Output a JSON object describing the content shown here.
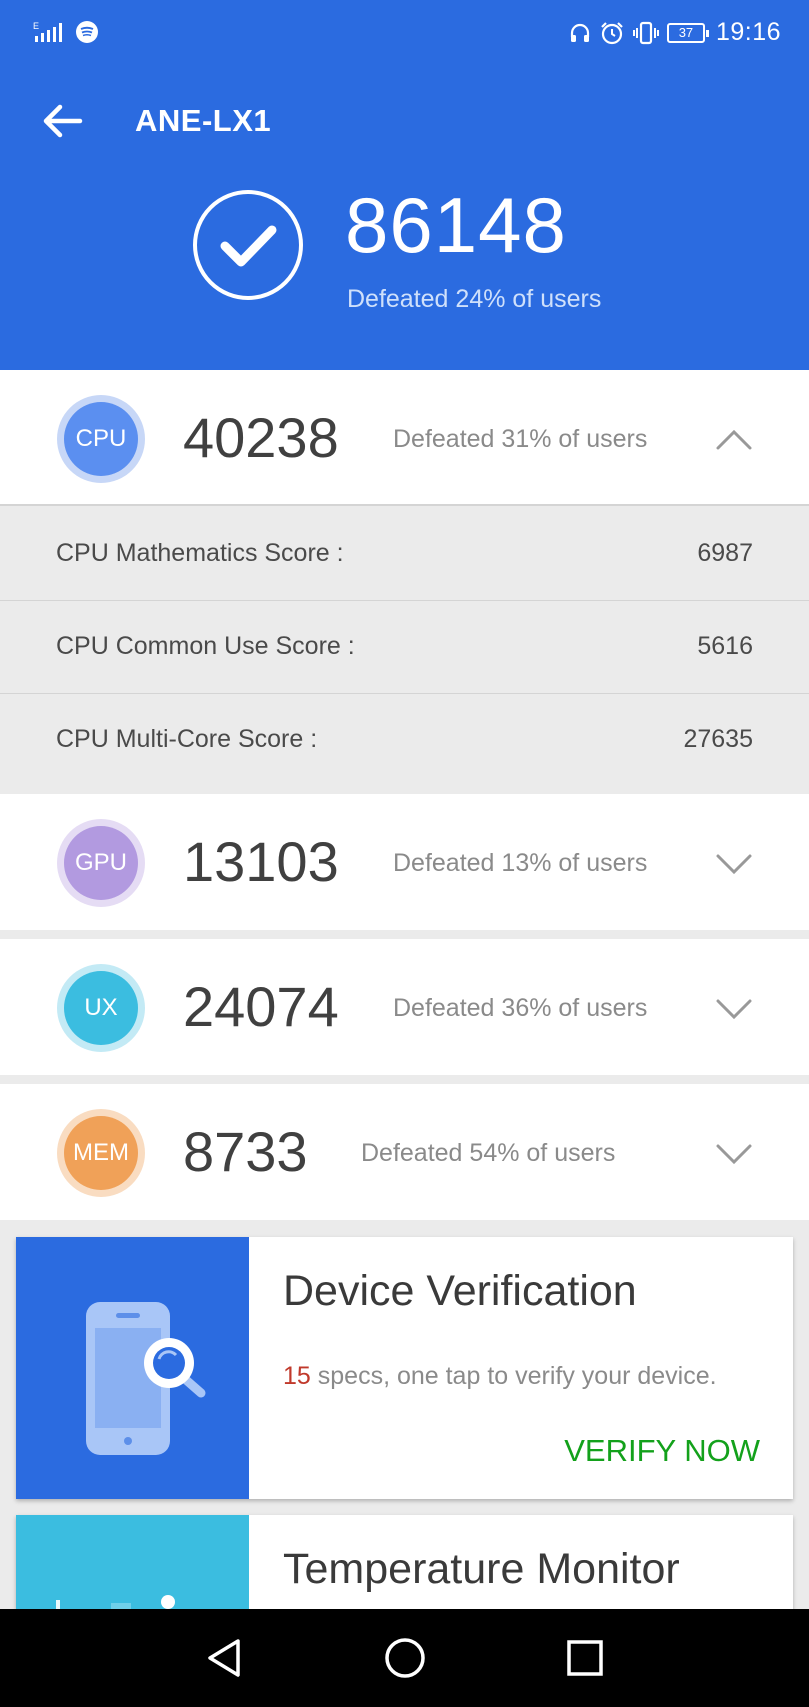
{
  "status_bar": {
    "time": "19:16",
    "battery": "37",
    "icons": [
      "signal-icon",
      "spotify-icon",
      "headphones-icon",
      "alarm-icon",
      "vibrate-icon",
      "battery-icon"
    ]
  },
  "header": {
    "device_name": "ANE-LX1",
    "total_score": "86148",
    "total_defeated": "Defeated 24% of users"
  },
  "scores": [
    {
      "badge": "CPU",
      "score": "40238",
      "defeated": "Defeated 31% of users",
      "expanded": true,
      "color": "#5b8ff0",
      "ring": "#c7d7f7"
    },
    {
      "badge": "GPU",
      "score": "13103",
      "defeated": "Defeated 13% of users",
      "expanded": false,
      "color": "#b29ae0",
      "ring": "#e5dcf4"
    },
    {
      "badge": "UX",
      "score": "24074",
      "defeated": "Defeated 36% of users",
      "expanded": false,
      "color": "#3bbde0",
      "ring": "#c3eaf5"
    },
    {
      "badge": "MEM",
      "score": "8733",
      "defeated": "Defeated 54% of users",
      "expanded": false,
      "color": "#f0a158",
      "ring": "#f9dcc1"
    }
  ],
  "cpu_details": [
    {
      "label": "CPU Mathematics Score :",
      "value": "6987"
    },
    {
      "label": "CPU Common Use Score :",
      "value": "5616"
    },
    {
      "label": "CPU Multi-Core Score :",
      "value": "27635"
    }
  ],
  "cards": {
    "verification": {
      "title": "Device Verification",
      "count": "15",
      "desc": " specs, one tap to verify your device.",
      "action": "VERIFY NOW"
    },
    "temperature": {
      "title": "Temperature Monitor"
    }
  },
  "colors": {
    "primary": "#2b6be0",
    "verify_green": "#13a11b",
    "highlight_red": "#c0392b",
    "temp_card": "#3bbde0"
  }
}
